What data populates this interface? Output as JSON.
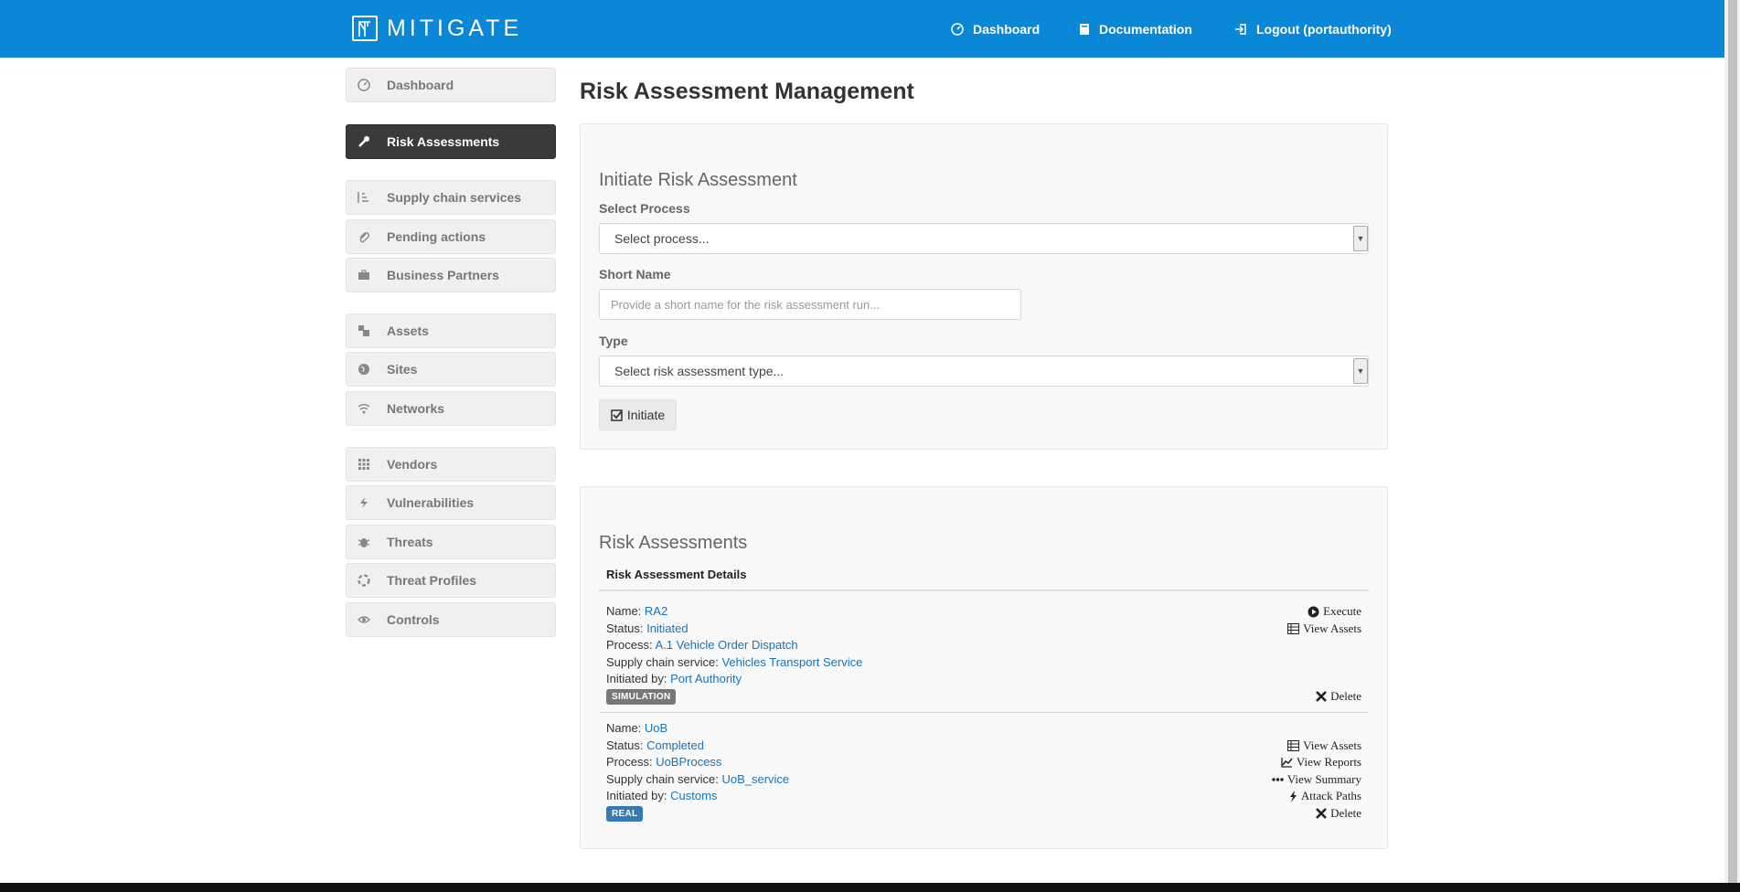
{
  "brand": {
    "name": "MITIGATE",
    "logo_icon": "harbor-crane-icon"
  },
  "topnav": {
    "dashboard": {
      "label": "Dashboard",
      "icon": "dashboard-circle-icon"
    },
    "documentation": {
      "label": "Documentation",
      "icon": "book-icon"
    },
    "logout": {
      "label": "Logout (portauthority)",
      "icon": "logout-icon"
    }
  },
  "sidebar": {
    "items": [
      {
        "label": "Dashboard",
        "icon": "dashboard-circle-icon",
        "active": false
      },
      {
        "label": "Risk Assessments",
        "icon": "wrench-icon",
        "active": true
      },
      {
        "label": "Supply chain services",
        "icon": "tasks-icon",
        "active": false
      },
      {
        "label": "Pending actions",
        "icon": "paperclip-icon",
        "active": false
      },
      {
        "label": "Business Partners",
        "icon": "briefcase-icon",
        "active": false
      },
      {
        "label": "Assets",
        "icon": "stacked-squares-icon",
        "active": false
      },
      {
        "label": "Sites",
        "icon": "globe-icon",
        "active": false
      },
      {
        "label": "Networks",
        "icon": "wifi-icon",
        "active": false
      },
      {
        "label": "Vendors",
        "icon": "grid-icon",
        "active": false
      },
      {
        "label": "Vulnerabilities",
        "icon": "bolt-icon",
        "active": false
      },
      {
        "label": "Threats",
        "icon": "bug-icon",
        "active": false
      },
      {
        "label": "Threat Profiles",
        "icon": "lifebuoy-icon",
        "active": false
      },
      {
        "label": "Controls",
        "icon": "eye-icon",
        "active": false
      }
    ]
  },
  "main": {
    "title": "Risk Assessment Management",
    "initiate": {
      "title": "Initiate Risk Assessment",
      "process_label": "Select Process",
      "process_value": "Select process...",
      "shortname_label": "Short Name",
      "shortname_placeholder": "Provide a short name for the risk assessment run...",
      "type_label": "Type",
      "type_value": "Select risk assessment type...",
      "button_label": "Initiate"
    },
    "assessments": {
      "title": "Risk Assessments",
      "header": "Risk Assessment Details",
      "field_labels": {
        "name": "Name: ",
        "status": "Status: ",
        "process": "Process: ",
        "service": "Supply chain service: ",
        "initiated_by": "Initiated by: "
      },
      "items": [
        {
          "name": "RA2",
          "status": "Initiated",
          "process": "A.1 Vehicle Order Dispatch",
          "service": "Vehicles Transport Service",
          "initiated_by": "Port Authority",
          "badge": "SIMULATION",
          "actions": [
            "Execute",
            "View Assets",
            "Delete"
          ]
        },
        {
          "name": "UoB",
          "status": "Completed",
          "process": "UoBProcess",
          "service": "UoB_service",
          "initiated_by": "Customs",
          "badge": "REAL",
          "actions": [
            "View Assets",
            "View Reports",
            "View Summary",
            "Attack Paths",
            "Delete"
          ]
        }
      ]
    }
  },
  "colors": {
    "navbar": "#0a87d6",
    "active_sidebar": "#3a3a3a",
    "link": "#1a73b8",
    "badge_simulation": "#777777",
    "badge_real": "#337ab7"
  }
}
